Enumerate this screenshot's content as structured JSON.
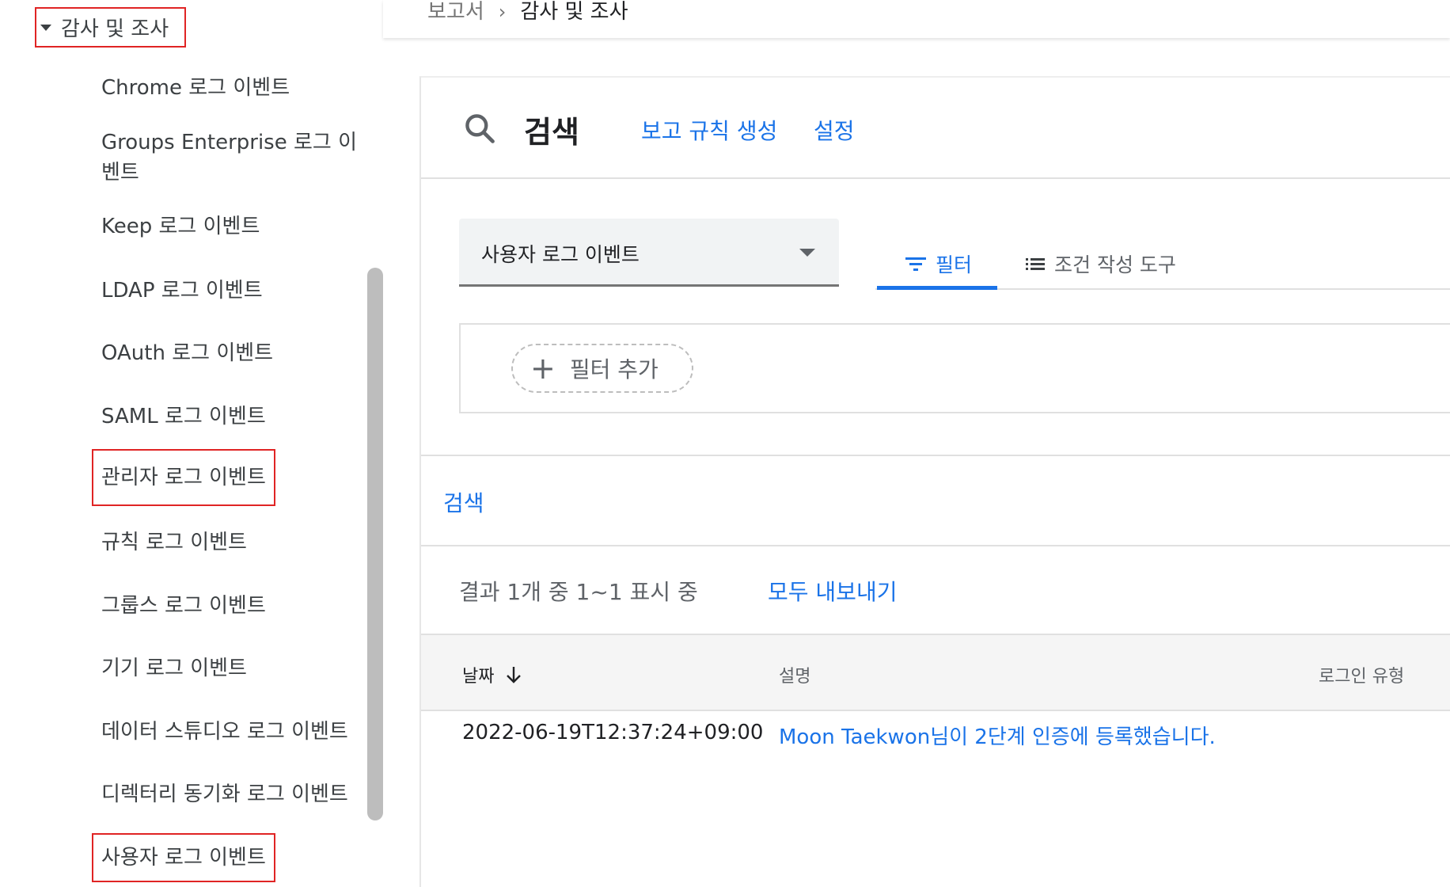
{
  "sidebar": {
    "section_label": "감사 및 조사",
    "items": [
      {
        "label": "Chrome 로그 이벤트"
      },
      {
        "label": "Groups Enterprise 로그 이"
      },
      {
        "label": "벤트"
      },
      {
        "label": "Keep 로그 이벤트"
      },
      {
        "label": "LDAP 로그 이벤트"
      },
      {
        "label": "OAuth 로그 이벤트"
      },
      {
        "label": "SAML 로그 이벤트"
      },
      {
        "label": "관리자 로그 이벤트"
      },
      {
        "label": "규칙 로그 이벤트"
      },
      {
        "label": "그룹스 로그 이벤트"
      },
      {
        "label": "기기 로그 이벤트"
      },
      {
        "label": "데이터 스튜디오 로그 이벤트"
      },
      {
        "label": "디렉터리 동기화 로그 이벤트"
      },
      {
        "label": "사용자 로그 이벤트"
      }
    ]
  },
  "breadcrumb": {
    "parent": "보고서",
    "separator": "›",
    "current": "감사 및 조사"
  },
  "search": {
    "title": "검색",
    "icon": "search-icon",
    "links": {
      "create_rule": "보고 규칙 생성",
      "settings": "설정"
    }
  },
  "data_source": {
    "selected": "사용자 로그 이벤트"
  },
  "tabs": [
    {
      "label": "필터",
      "icon": "filter-icon",
      "active": true
    },
    {
      "label": "조건 작성 도구",
      "icon": "list-icon",
      "active": false
    }
  ],
  "filter": {
    "add_label": "필터 추가"
  },
  "actions": {
    "search_button": "검색"
  },
  "results": {
    "count_text": "결과 1개 중 1~1 표시 중",
    "export_label": "모두 내보내기"
  },
  "table": {
    "columns": {
      "date": "날짜",
      "description": "설명",
      "login_type": "로그인 유형"
    },
    "rows": [
      {
        "date": "2022-06-19T12:37:24+09:00",
        "description": "Moon Taekwon님이 2단계 인증에 등록했습니다.",
        "login_type": ""
      }
    ]
  },
  "colors": {
    "accent": "#1a73e8",
    "highlight_border": "#e02424",
    "header_bg": "#f5f5f5"
  }
}
